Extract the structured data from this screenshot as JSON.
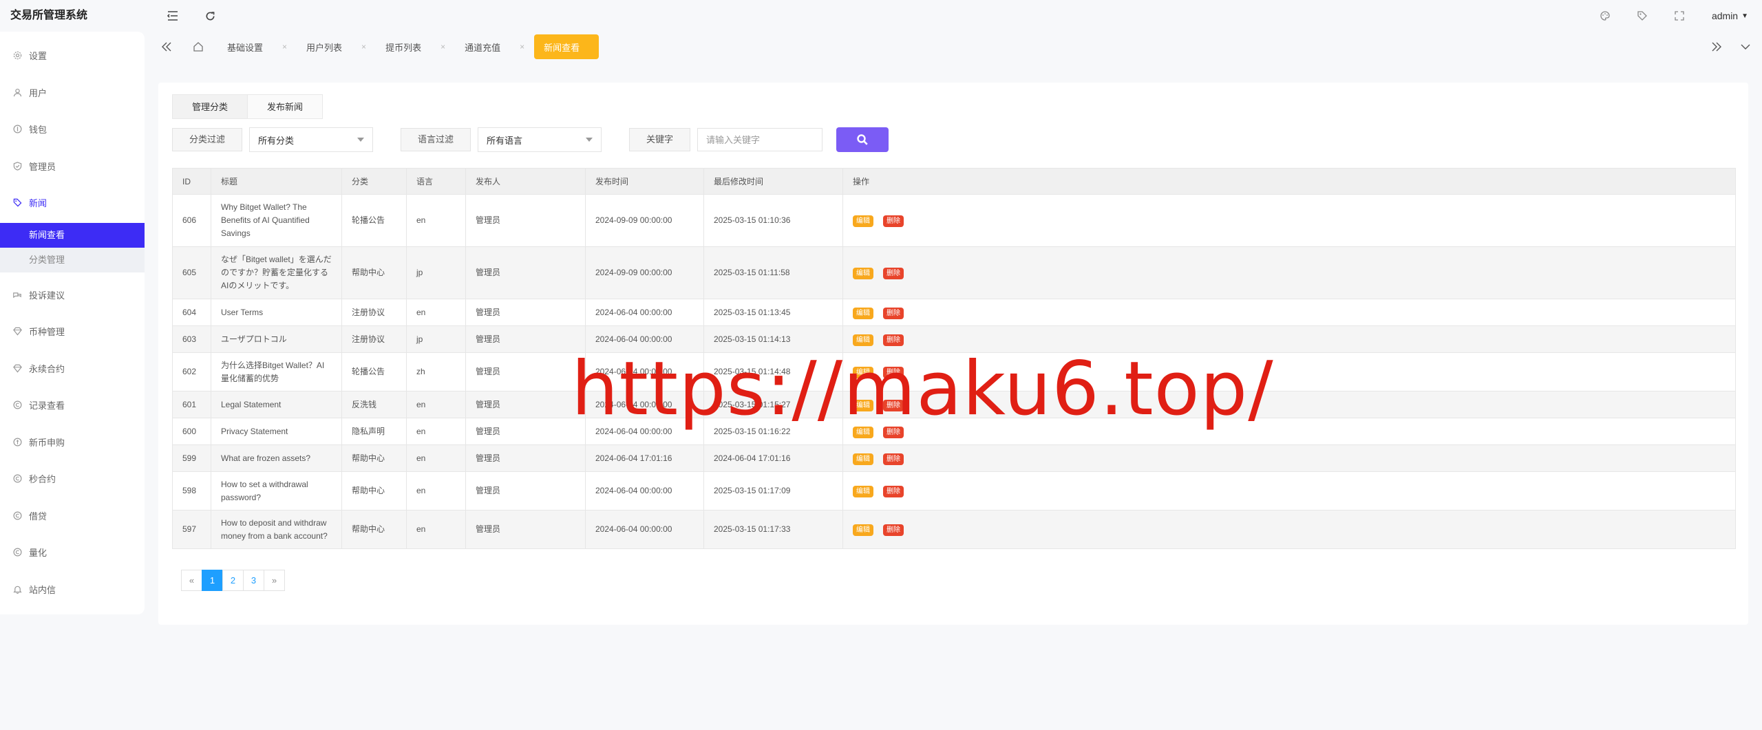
{
  "app": {
    "brand": "交易所管理系统",
    "user": "admin"
  },
  "sidebar": {
    "items": [
      {
        "label": "设置",
        "icon": "gear-icon"
      },
      {
        "label": "用户",
        "icon": "user-icon"
      },
      {
        "label": "钱包",
        "icon": "wallet-icon"
      },
      {
        "label": "管理员",
        "icon": "shield-icon"
      },
      {
        "label": "新闻",
        "icon": "tag-icon",
        "open": true,
        "children": [
          {
            "label": "新闻查看",
            "active": true
          },
          {
            "label": "分类管理"
          }
        ]
      },
      {
        "label": "投诉建议",
        "icon": "chat-icon"
      },
      {
        "label": "币种管理",
        "icon": "diamond-icon"
      },
      {
        "label": "永续合约",
        "icon": "diamond-icon"
      },
      {
        "label": "记录查看",
        "icon": "copyright-icon"
      },
      {
        "label": "新币申购",
        "icon": "coin-icon"
      },
      {
        "label": "秒合约",
        "icon": "copyright-icon"
      },
      {
        "label": "借贷",
        "icon": "copyright-icon"
      },
      {
        "label": "量化",
        "icon": "copyright-icon"
      },
      {
        "label": "站内信",
        "icon": "bell-icon"
      }
    ]
  },
  "tabs": [
    {
      "label": "基础设置",
      "active": false
    },
    {
      "label": "用户列表",
      "active": false
    },
    {
      "label": "提币列表",
      "active": false
    },
    {
      "label": "通道充值",
      "active": false
    },
    {
      "label": "新闻查看",
      "active": true
    }
  ],
  "subtabs": {
    "manage_category": "管理分类",
    "publish_news": "发布新闻"
  },
  "filters": {
    "category_label": "分类过滤",
    "category_value": "所有分类",
    "language_label": "语言过滤",
    "language_value": "所有语言",
    "keyword_label": "关键字",
    "keyword_placeholder": "请输入关键字"
  },
  "table": {
    "headers": [
      "ID",
      "标题",
      "分类",
      "语言",
      "发布人",
      "发布时间",
      "最后修改时间",
      "操作"
    ],
    "actions": {
      "edit": "编辑",
      "delete": "删除"
    },
    "rows": [
      {
        "id": "606",
        "title": "Why Bitget Wallet? The Benefits of AI Quantified Savings",
        "category": "轮播公告",
        "lang": "en",
        "author": "管理员",
        "published": "2024-09-09 00:00:00",
        "modified": "2025-03-15 01:10:36"
      },
      {
        "id": "605",
        "title": "なぜ「Bitget wallet」を選んだのですか？貯蓄を定量化するAIのメリットです。",
        "category": "帮助中心",
        "lang": "jp",
        "author": "管理员",
        "published": "2024-09-09 00:00:00",
        "modified": "2025-03-15 01:11:58"
      },
      {
        "id": "604",
        "title": "User Terms",
        "category": "注册协议",
        "lang": "en",
        "author": "管理员",
        "published": "2024-06-04 00:00:00",
        "modified": "2025-03-15 01:13:45"
      },
      {
        "id": "603",
        "title": "ユーザプロトコル",
        "category": "注册协议",
        "lang": "jp",
        "author": "管理员",
        "published": "2024-06-04 00:00:00",
        "modified": "2025-03-15 01:14:13"
      },
      {
        "id": "602",
        "title": " 为什么选择Bitget Wallet？AI量化储蓄的优势",
        "category": "轮播公告",
        "lang": "zh",
        "author": "管理员",
        "published": "2024-06-04 00:00:00",
        "modified": "2025-03-15 01:14:48"
      },
      {
        "id": "601",
        "title": "Legal Statement",
        "category": "反洗钱",
        "lang": "en",
        "author": "管理员",
        "published": "2024-06-04 00:00:00",
        "modified": "2025-03-15 01:15:27"
      },
      {
        "id": "600",
        "title": "Privacy Statement",
        "category": "隐私声明",
        "lang": "en",
        "author": "管理员",
        "published": "2024-06-04 00:00:00",
        "modified": "2025-03-15 01:16:22"
      },
      {
        "id": "599",
        "title": "What are frozen assets?",
        "category": "帮助中心",
        "lang": "en",
        "author": "管理员",
        "published": "2024-06-04 17:01:16",
        "modified": "2024-06-04 17:01:16"
      },
      {
        "id": "598",
        "title": "How to set a withdrawal password?",
        "category": "帮助中心",
        "lang": "en",
        "author": "管理员",
        "published": "2024-06-04 00:00:00",
        "modified": "2025-03-15 01:17:09"
      },
      {
        "id": "597",
        "title": "How to deposit and withdraw money from a bank account?",
        "category": "帮助中心",
        "lang": "en",
        "author": "管理员",
        "published": "2024-06-04 00:00:00",
        "modified": "2025-03-15 01:17:33"
      }
    ]
  },
  "pager": {
    "prev": "«",
    "pages": [
      "1",
      "2",
      "3"
    ],
    "current": "1",
    "next": "»"
  },
  "watermark": "https://maku6.top/",
  "colors": {
    "active_nav": "#3d2cf5",
    "active_tab": "#fcb61a",
    "search": "#7b5cf5",
    "edit": "#f8a81d",
    "delete": "#e8442b",
    "pager": "#1e9fff",
    "watermark": "#e01f14"
  }
}
